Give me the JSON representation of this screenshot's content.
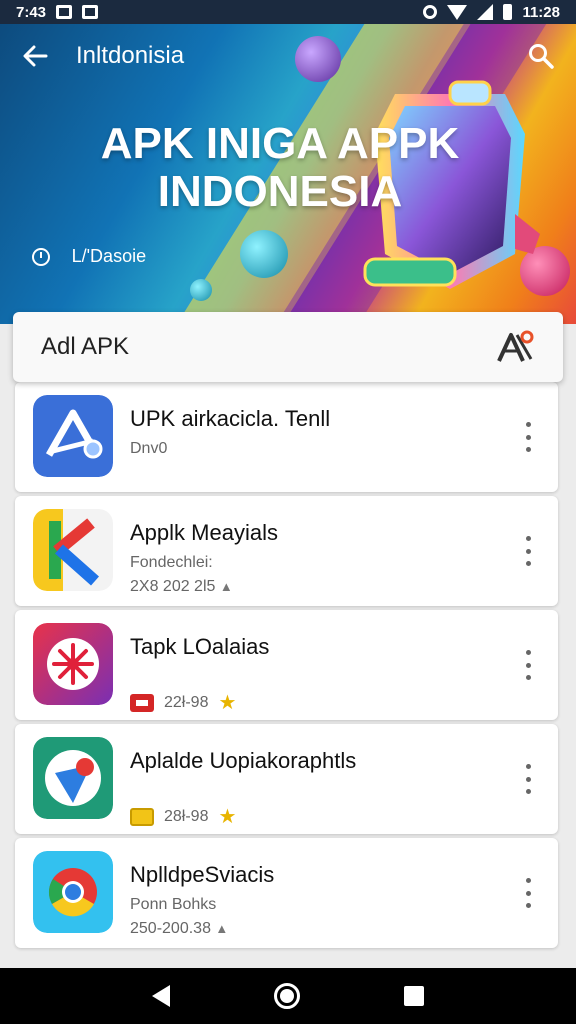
{
  "status_bar": {
    "time": "7:43",
    "clock_right": "11:28",
    "icons": [
      "notification-n-icon",
      "notification-app-icon",
      "sync-icon",
      "wifi-icon",
      "signal-icon",
      "battery-icon"
    ]
  },
  "header": {
    "title": "Inltdonisia",
    "back_icon": "back-arrow-icon",
    "search_icon": "search-icon"
  },
  "hero": {
    "title_line1": "APK INIGA APPK",
    "title_line2": "INDONESIA",
    "subtitle": "   L/'Dasoie"
  },
  "search_card": {
    "label": "Adl APK",
    "icon": "apk-icon"
  },
  "apps": [
    {
      "title": "UPK airkacicla. Tenll",
      "meta1": "Dnv0",
      "meta2": "",
      "icon": "app-arrow-icon"
    },
    {
      "title": "Applk Meayials",
      "meta1": "Fondechlei:",
      "meta2": "2X8 202 2l5",
      "icon": "app-k-icon"
    },
    {
      "title": "Tapk LOalaias",
      "meta1": "",
      "meta2": "22ł-98",
      "icon": "app-flower-icon"
    },
    {
      "title": "Aplalde Uopiakoraphtls",
      "meta1": "",
      "meta2": "28ł-98",
      "icon": "app-pin-icon"
    },
    {
      "title": "NplldpeSviacis",
      "meta1": "Ponn Bohks",
      "meta2": "250-200.38",
      "icon": "app-chrome-icon"
    }
  ],
  "nav_bar": {
    "icons": [
      "nav-back-icon",
      "nav-home-icon",
      "nav-recents-icon"
    ]
  }
}
